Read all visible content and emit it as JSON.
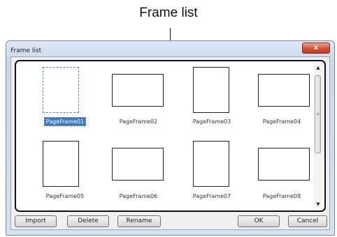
{
  "callout": {
    "label": "Frame list"
  },
  "dialog": {
    "title": "Frame list",
    "close_glyph": "x"
  },
  "frames": [
    {
      "label": "PageFrame01",
      "orientation": "portrait",
      "selected": true
    },
    {
      "label": "PageFrame02",
      "orientation": "landscape",
      "selected": false
    },
    {
      "label": "PageFrame03",
      "orientation": "portrait",
      "selected": false
    },
    {
      "label": "PageFrame04",
      "orientation": "landscape",
      "selected": false
    },
    {
      "label": "PageFrame05",
      "orientation": "portrait",
      "selected": false
    },
    {
      "label": "PageFrame06",
      "orientation": "landscape",
      "selected": false
    },
    {
      "label": "PageFrame07",
      "orientation": "portrait",
      "selected": false
    },
    {
      "label": "PageFrame08",
      "orientation": "landscape",
      "selected": false
    }
  ],
  "buttons": {
    "import": "Import",
    "delete": "Delete",
    "rename": "Rename",
    "ok": "OK",
    "cancel": "Cancel"
  },
  "colors": {
    "selection": "#3a78c8",
    "close_button": "#d7553c"
  }
}
